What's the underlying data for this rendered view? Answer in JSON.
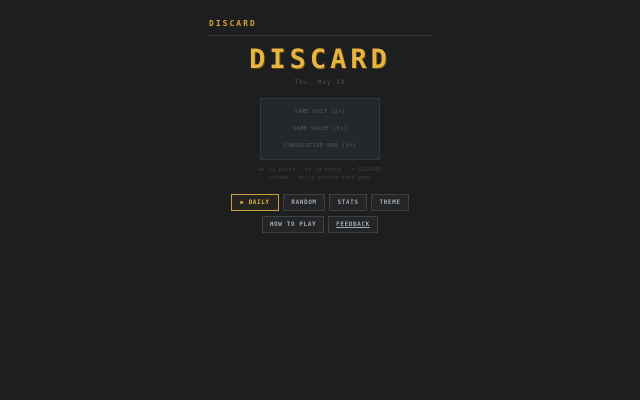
{
  "header": {
    "brand": "DISCARD"
  },
  "main": {
    "title": "DISCARD",
    "date": "Thu, May 28"
  },
  "rules": [
    "SAME SUIT (2×)",
    "SAME VALUE (3×)",
    "CONSECUTIVE RUN (3×)"
  ],
  "scoring": {
    "line1": "w+ 12 point  ·  m+ 14 bonus  ·  × DISCARD",
    "line2": "streak · daily puzzle each game"
  },
  "buttons": {
    "daily_icon": "▶",
    "daily": "DAILY",
    "random": "RANDOM",
    "stats": "STATS",
    "theme": "THEME",
    "how_to_play": "HOW TO PLAY",
    "feedback": "FEEDBACK"
  },
  "colors": {
    "background": "#1c1e20",
    "accent": "#e7b43e",
    "button_border": "#3d4144"
  }
}
